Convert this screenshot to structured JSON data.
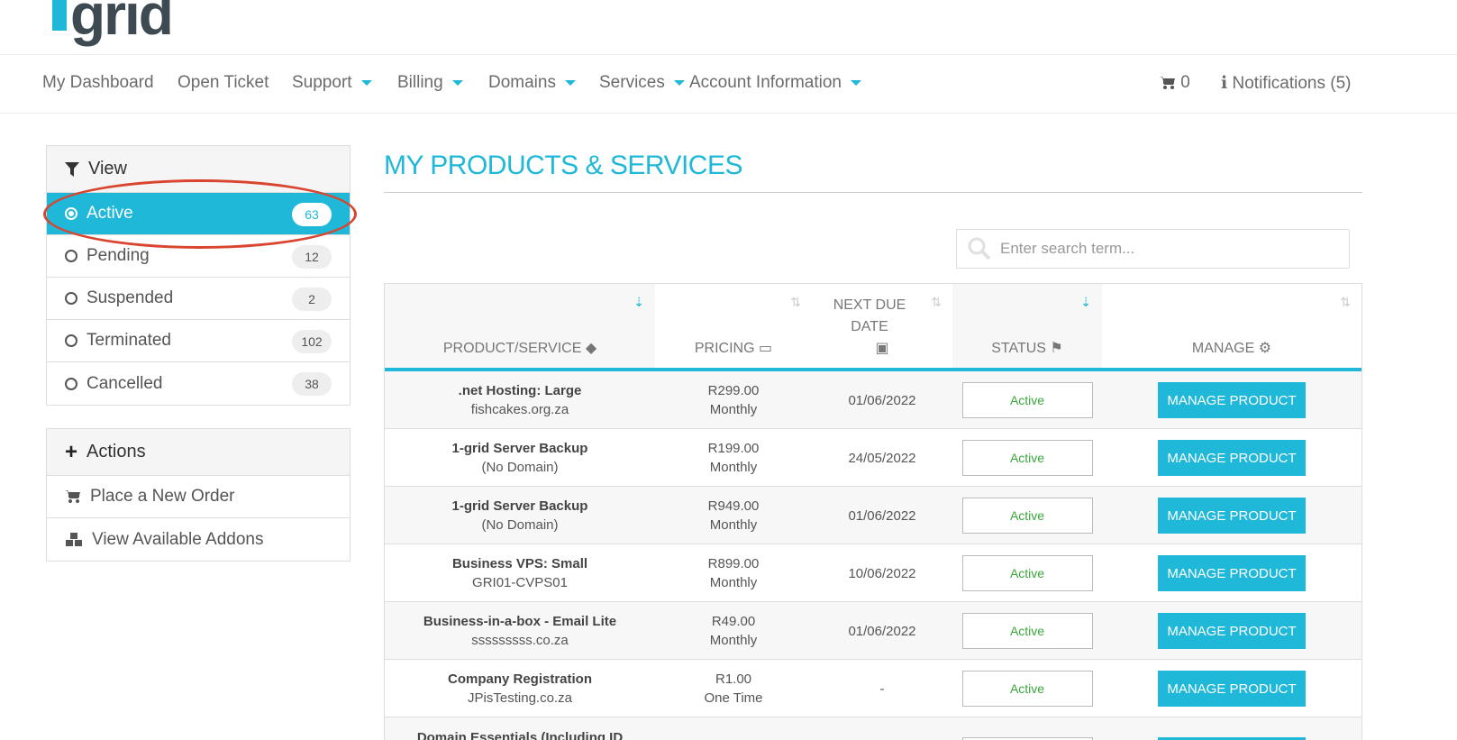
{
  "brand": {
    "logo_text": "grid",
    "accent": "#1fb8d8"
  },
  "nav": {
    "items": [
      {
        "label": "My Dashboard",
        "dropdown": false
      },
      {
        "label": "Open Ticket",
        "dropdown": false
      },
      {
        "label": "Support",
        "dropdown": true
      },
      {
        "label": "Billing",
        "dropdown": true
      },
      {
        "label": "Domains",
        "dropdown": true
      },
      {
        "label": "Services",
        "dropdown": true
      },
      {
        "label": "Account Information",
        "dropdown": true
      }
    ],
    "cart_count": "0",
    "notifications": "Notifications (5)"
  },
  "sidebar": {
    "view": {
      "title": "View",
      "filters": [
        {
          "label": "Active",
          "count": "63",
          "selected": true
        },
        {
          "label": "Pending",
          "count": "12",
          "selected": false
        },
        {
          "label": "Suspended",
          "count": "2",
          "selected": false
        },
        {
          "label": "Terminated",
          "count": "102",
          "selected": false
        },
        {
          "label": "Cancelled",
          "count": "38",
          "selected": false
        }
      ]
    },
    "actions": {
      "title": "Actions",
      "items": [
        {
          "label": "Place a New Order",
          "icon": "cart-icon"
        },
        {
          "label": "View Available Addons",
          "icon": "cubes-icon"
        }
      ]
    }
  },
  "main": {
    "title": "MY PRODUCTS & SERVICES",
    "search_placeholder": "Enter search term...",
    "table": {
      "headers": [
        "PRODUCT/SERVICE",
        "PRICING",
        "NEXT DUE DATE",
        "STATUS",
        "MANAGE"
      ],
      "rows": [
        {
          "product": ".net Hosting: Large",
          "domain": "fishcakes.org.za",
          "price": "R299.00",
          "cycle": "Monthly",
          "due": "01/06/2022",
          "status": "Active",
          "action": "MANAGE PRODUCT"
        },
        {
          "product": "1-grid Server Backup",
          "domain": "(No Domain)",
          "price": "R199.00",
          "cycle": "Monthly",
          "due": "24/05/2022",
          "status": "Active",
          "action": "MANAGE PRODUCT"
        },
        {
          "product": "1-grid Server Backup",
          "domain": "(No Domain)",
          "price": "R949.00",
          "cycle": "Monthly",
          "due": "01/06/2022",
          "status": "Active",
          "action": "MANAGE PRODUCT"
        },
        {
          "product": "Business VPS: Small",
          "domain": "GRI01-CVPS01",
          "price": "R899.00",
          "cycle": "Monthly",
          "due": "10/06/2022",
          "status": "Active",
          "action": "MANAGE PRODUCT"
        },
        {
          "product": "Business-in-a-box - Email Lite",
          "domain": "sssssssss.co.za",
          "price": "R49.00",
          "cycle": "Monthly",
          "due": "01/06/2022",
          "status": "Active",
          "action": "MANAGE PRODUCT"
        },
        {
          "product": "Company Registration",
          "domain": "JPisTesting.co.za",
          "price": "R1.00",
          "cycle": "One Time",
          "due": "-",
          "status": "Active",
          "action": "MANAGE PRODUCT"
        },
        {
          "product": "Domain Essentials (Including ID",
          "domain": "",
          "price": "",
          "cycle": "",
          "due": "",
          "status": "",
          "action": ""
        }
      ]
    }
  }
}
